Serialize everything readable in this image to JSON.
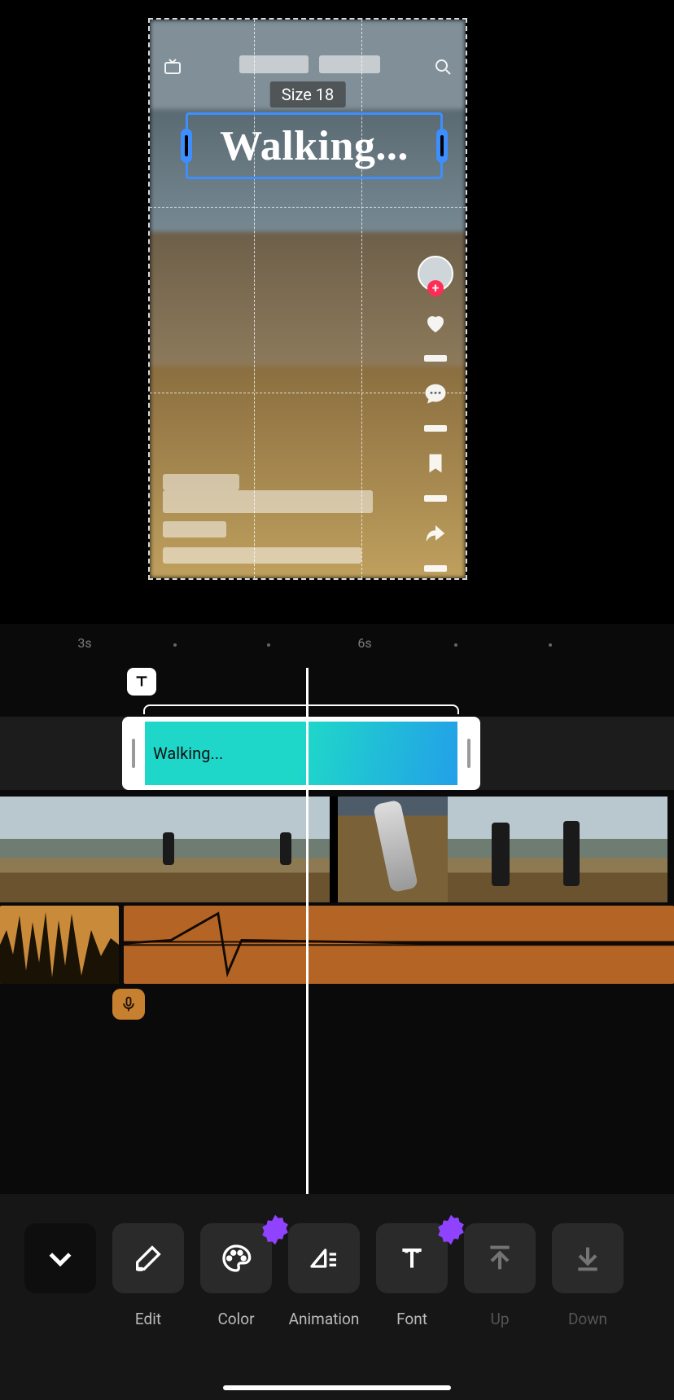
{
  "preview": {
    "size_badge": "Size 18",
    "caption_text": "Walking..."
  },
  "side_icons": {
    "avatar": "avatar",
    "plus": "+",
    "like": "like-icon",
    "comment": "comment-icon",
    "bookmark": "bookmark-icon",
    "share": "share-icon",
    "disc": "music-disc"
  },
  "timeline": {
    "ruler": [
      "3s",
      "6s"
    ],
    "text_clip_label": "Walking..."
  },
  "toolbar": {
    "collapse": "",
    "items": {
      "edit": "Edit",
      "color": "Color",
      "animation": "Animation",
      "font": "Font",
      "up": "Up",
      "down": "Down"
    }
  }
}
